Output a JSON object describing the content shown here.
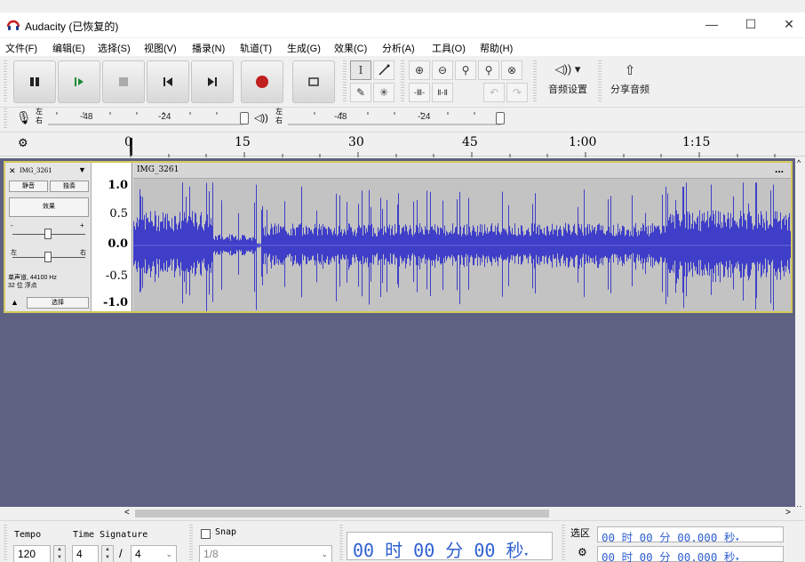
{
  "window": {
    "title": "Audacity (已恢复的)",
    "minimize": "—",
    "maximize": "☐",
    "close": "✕"
  },
  "menu": [
    "文件(F)",
    "编辑(E)",
    "选择(S)",
    "视图(V)",
    "播录(N)",
    "轨道(T)",
    "生成(G)",
    "效果(C)",
    "分析(A)",
    "工具(O)",
    "帮助(H)"
  ],
  "transport": {
    "pause_icon": "pause-icon",
    "play_icon": "play-icon",
    "stop_icon": "stop-icon",
    "skip_start_icon": "skip-to-start-icon",
    "skip_end_icon": "skip-to-end-icon",
    "record_icon": "record-icon",
    "loop_icon": "loop-icon",
    "record_color": "#c0201e"
  },
  "tools": {
    "audio_setup_label": "音频设置",
    "share_audio_label": "分享音频",
    "audio_setup_glyph": "◁)) ▾",
    "share_glyph": "⇧"
  },
  "meters": {
    "record": {
      "l": "左",
      "r": "右",
      "ticks": [
        "-48",
        "-24"
      ]
    },
    "play": {
      "l": "左",
      "r": "右",
      "ticks": [
        "-48",
        "-24"
      ]
    }
  },
  "timeline": {
    "labels": [
      "0",
      "15",
      "30",
      "45",
      "1:00",
      "1:15"
    ]
  },
  "track": {
    "name": "IMG_3261",
    "clip_name": "IMG_3261",
    "mute": "静音",
    "solo": "独奏",
    "effects": "效果",
    "gain_min": "-",
    "gain_max": "+",
    "pan_left": "左",
    "pan_right": "右",
    "info_line1": "单声道, 44100 Hz",
    "info_line2": "32 位 浮点",
    "select": "选择",
    "close_icon": "✕",
    "menu_arrow": "▼",
    "collapse_arrow": "▲",
    "clip_menu": "...",
    "wave_color": "#3e3ec8",
    "vruler": [
      "1.0",
      "0.5",
      "0.0",
      "-0.5",
      "-1.0"
    ]
  },
  "scroll": {
    "left": "<",
    "right": ">",
    "up": "^",
    "down": "v"
  },
  "bottom": {
    "tempo_label": "Tempo",
    "tempo_value": "120",
    "time_signature_label": "Time Signature",
    "ts_numerator": "4",
    "ts_slash": "/",
    "ts_denominator": "4",
    "snap_label": "Snap",
    "snap_value": "1/8",
    "time_display": "00 时 00 分 00 秒",
    "selection_label": "选区",
    "selection_start": "00 时 00 分 00.000 秒",
    "selection_end": "00 时 00 分 00.000 秒"
  }
}
